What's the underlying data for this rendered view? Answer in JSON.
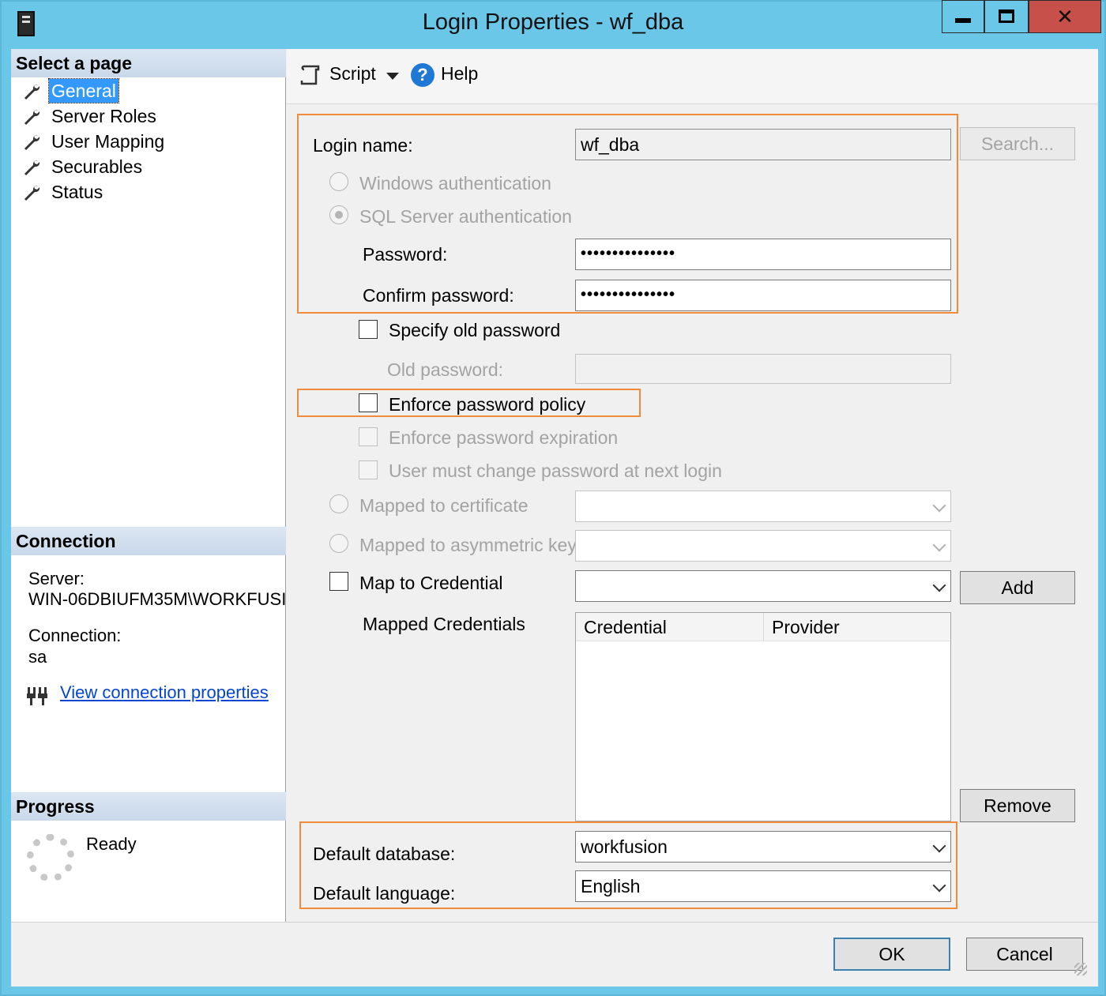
{
  "window": {
    "title": "Login Properties - wf_dba",
    "controls": {
      "minimize_icon": "minimize-icon",
      "maximize_icon": "maximize-icon",
      "close_label": "✕"
    }
  },
  "left": {
    "select_page_header": "Select a page",
    "pages": [
      {
        "label": "General",
        "selected": true
      },
      {
        "label": "Server Roles"
      },
      {
        "label": "User Mapping"
      },
      {
        "label": "Securables"
      },
      {
        "label": "Status"
      }
    ],
    "connection_header": "Connection",
    "server_label": "Server:",
    "server_value": "WIN-06DBIUFM35M\\WORKFUSI",
    "connection_label": "Connection:",
    "connection_value": "sa",
    "view_link": "View connection properties",
    "progress_header": "Progress",
    "progress_status": "Ready"
  },
  "toolbar": {
    "script_label": "Script",
    "help_label": "Help"
  },
  "form": {
    "login_name_label": "Login name:",
    "login_name_value": "wf_dba",
    "search_button": "Search...",
    "windows_auth": "Windows authentication",
    "sql_auth": "SQL Server authentication",
    "password_label": "Password:",
    "password_value": "•••••••••••••••",
    "confirm_label": "Confirm password:",
    "confirm_value": "•••••••••••••••",
    "specify_old": "Specify old password",
    "old_password_label": "Old password:",
    "enforce_policy": "Enforce password policy",
    "enforce_expiration": "Enforce password expiration",
    "must_change": "User must change password at next login",
    "mapped_cert": "Mapped to certificate",
    "mapped_asym": "Mapped to asymmetric key",
    "map_credential": "Map to Credential",
    "add_button": "Add",
    "mapped_credentials_label": "Mapped Credentials",
    "grid_columns": [
      "Credential",
      "Provider"
    ],
    "remove_button": "Remove",
    "default_db_label": "Default database:",
    "default_db_value": "workfusion",
    "default_lang_label": "Default language:",
    "default_lang_value": "English"
  },
  "footer": {
    "ok": "OK",
    "cancel": "Cancel"
  },
  "colors": {
    "titlebar": "#6bc7e8",
    "close": "#c7504a",
    "highlight": "#f08a3c",
    "selection": "#3399ff",
    "link": "#0645d0"
  }
}
